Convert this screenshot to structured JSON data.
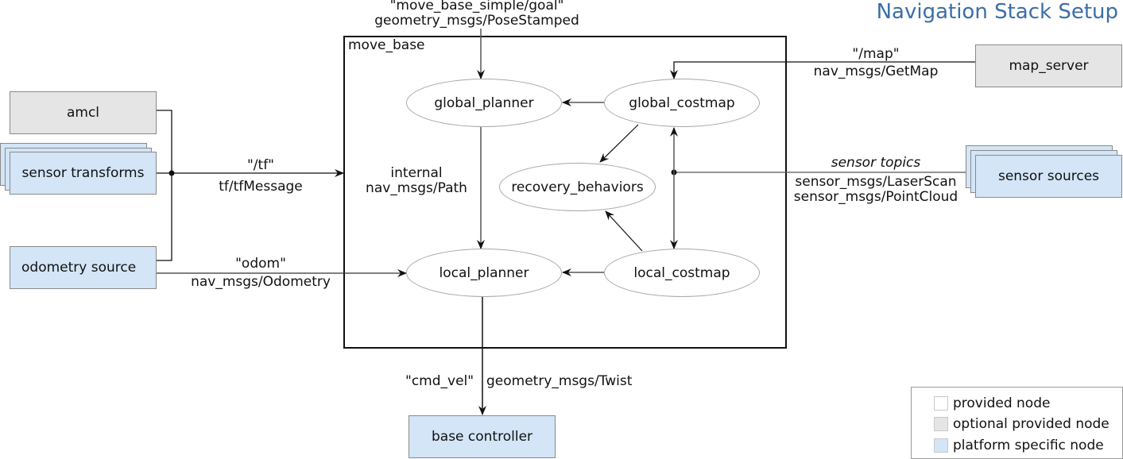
{
  "title": "Navigation Stack Setup",
  "container": {
    "label": "move_base"
  },
  "nodes": {
    "amcl": {
      "label": "amcl",
      "type": "optional provided node"
    },
    "sensor_transforms": {
      "label": "sensor transforms",
      "type": "platform specific node",
      "stacked": true
    },
    "odometry_source": {
      "label": "odometry source",
      "type": "platform specific node"
    },
    "map_server": {
      "label": "map_server",
      "type": "optional provided node"
    },
    "sensor_sources": {
      "label": "sensor sources",
      "type": "platform specific node",
      "stacked": true
    },
    "base_controller": {
      "label": "base controller",
      "type": "platform specific node"
    },
    "global_planner": {
      "label": "global_planner",
      "type": "provided node"
    },
    "global_costmap": {
      "label": "global_costmap",
      "type": "provided node"
    },
    "recovery_behaviors": {
      "label": "recovery_behaviors",
      "type": "provided node"
    },
    "local_planner": {
      "label": "local_planner",
      "type": "provided node"
    },
    "local_costmap": {
      "label": "local_costmap",
      "type": "provided node"
    }
  },
  "edges": {
    "goal": {
      "topic": "\"move_base_simple/goal\"",
      "msg": "geometry_msgs/PoseStamped",
      "from": "external",
      "to": "global_planner"
    },
    "tf": {
      "topic": "\"/tf\"",
      "msg": "tf/tfMessage",
      "from": [
        "amcl",
        "sensor_transforms",
        "odometry_source"
      ],
      "to": "move_base"
    },
    "odom": {
      "topic": "\"odom\"",
      "msg": "nav_msgs/Odometry",
      "from": "odometry_source",
      "to": "local_planner"
    },
    "map": {
      "topic": "\"/map\"",
      "msg": "nav_msgs/GetMap",
      "from": "map_server",
      "to": "global_costmap"
    },
    "sensor": {
      "topic": "sensor topics",
      "msgs": [
        "sensor_msgs/LaserScan",
        "sensor_msgs/PointCloud"
      ],
      "from": "sensor_sources",
      "to": [
        "global_costmap",
        "local_costmap"
      ]
    },
    "path": {
      "topic": "internal",
      "msg": "nav_msgs/Path",
      "from": "global_planner",
      "to": "local_planner"
    },
    "cmd_vel": {
      "topic": "\"cmd_vel\"",
      "msg": "geometry_msgs/Twist",
      "from": "local_planner",
      "to": "base_controller"
    }
  },
  "legend": {
    "items": [
      {
        "label": "provided node",
        "color": "#ffffff"
      },
      {
        "label": "optional provided node",
        "color": "#e5e5e5"
      },
      {
        "label": "platform specific node",
        "color": "#d3e5f7"
      }
    ]
  },
  "colors": {
    "title": "#3b6ea5",
    "platform": "#d3e5f7",
    "optional": "#e5e5e5",
    "provided": "#ffffff"
  }
}
